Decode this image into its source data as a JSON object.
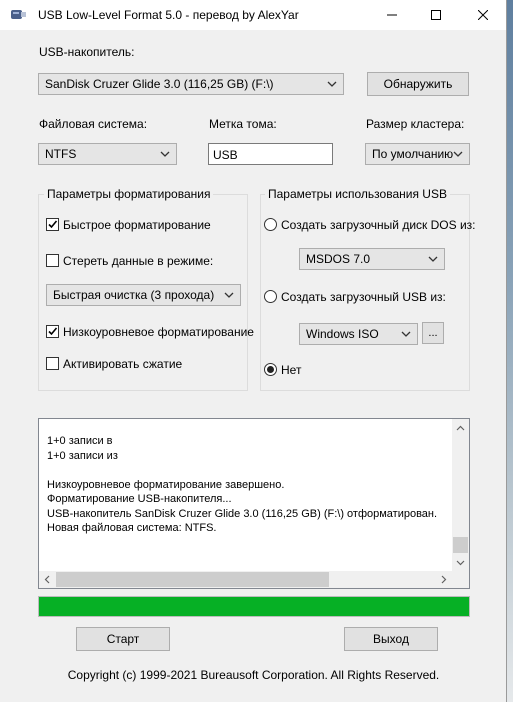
{
  "window": {
    "title": "USB Low-Level Format 5.0 - перевод by AlexYar",
    "controls": [
      "minimize-icon",
      "maximize-icon",
      "close-icon"
    ]
  },
  "usb_drive": {
    "label": "USB-накопитель:",
    "selected": "SanDisk Cruzer Glide 3.0 (116,25 GB) (F:\\)",
    "detect_button": "Обнаружить"
  },
  "file_system": {
    "label": "Файловая система:",
    "selected": "NTFS"
  },
  "volume_label": {
    "label": "Метка тома:",
    "value": "USB"
  },
  "cluster_size": {
    "label": "Размер кластера:",
    "selected": "По умолчанию"
  },
  "format_params": {
    "title": "Параметры форматирования",
    "quick_format": {
      "label": "Быстрое форматирование",
      "checked": true
    },
    "wipe_mode": {
      "label": "Стереть данные в режиме:",
      "checked": false
    },
    "wipe_method": "Быстрая очистка (3 прохода)",
    "low_level": {
      "label": "Низкоуровневое форматирование",
      "checked": true
    },
    "compression": {
      "label": "Активировать сжатие",
      "checked": false
    }
  },
  "usb_params": {
    "title": "Параметры использования USB",
    "dos_boot": {
      "label": "Создать загрузочный диск DOS из:",
      "selected": false
    },
    "dos_version": "MSDOS 7.0",
    "usb_boot": {
      "label": "Создать загрузочный USB из:",
      "selected": false
    },
    "iso_source": "Windows ISO",
    "browse_button": "...",
    "none": {
      "label": "Нет",
      "selected": true
    }
  },
  "log": {
    "lines": [
      "1+0 записи в",
      "1+0 записи из",
      "",
      "Низкоуровневое форматирование завершено.",
      "Форматирование USB-накопителя...",
      "USB-накопитель SanDisk Cruzer Glide 3.0 (116,25 GB) (F:\\) отформатирован.",
      "Новая файловая система: NTFS."
    ]
  },
  "progress": {
    "percent": 100,
    "color": "#06b025"
  },
  "buttons": {
    "start": "Старт",
    "exit": "Выход"
  },
  "copyright": "Copyright (c) 1999-2021 Bureausoft Corporation. All Rights Reserved."
}
